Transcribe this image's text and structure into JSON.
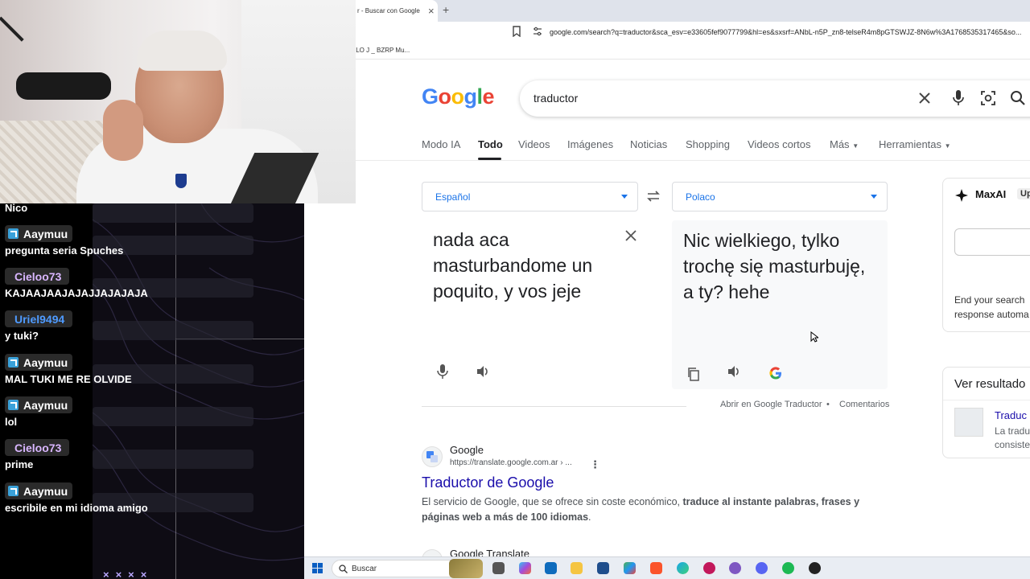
{
  "browser": {
    "tab_title": "r - Buscar con Google",
    "tab_close": "×",
    "new_tab": "+",
    "url": "google.com/search?q=traductor&sca_esv=e33605fef9077799&hl=es&sxsrf=ANbL-n5P_zn8-telseR4m8pGTSWJZ-8N6w%3A1768535317465&so...",
    "bookmark": "ILO J _ BZRP Mu..."
  },
  "google": {
    "logo": [
      "G",
      "o",
      "o",
      "g",
      "l",
      "e"
    ],
    "logo_colors": [
      "#4285F4",
      "#EA4335",
      "#FBBC05",
      "#4285F4",
      "#34A853",
      "#EA4335"
    ],
    "query": "traductor",
    "nav_tabs": [
      "Modo IA",
      "Todo",
      "Videos",
      "Imágenes",
      "Noticias",
      "Shopping",
      "Videos cortos",
      "Más",
      "Herramientas"
    ],
    "active_tab": "Todo"
  },
  "translator": {
    "source_lang": "Español",
    "target_lang": "Polaco",
    "source_text": "nada aca masturbandome un poquito, y vos jeje",
    "target_text": "Nic wielkiego, tylko trochę się masturbuję, a ty? hehe",
    "open_link": "Abrir en Google Traductor",
    "separator": "•",
    "feedback": "Comentarios"
  },
  "results": [
    {
      "source": "Google",
      "url": "https://translate.google.com.ar › ...",
      "title": "Traductor de Google",
      "snippet_plain": "El servicio de Google, que se ofrece sin coste económico, ",
      "snippet_bold": "traduce al instante palabras, frases y páginas web a más de 100 idiomas",
      "snippet_end": "."
    },
    {
      "source": "Google Translate"
    }
  ],
  "sidebar": {
    "maxai_title": "MaxAI",
    "maxai_badge": "Up",
    "maxai_text_1": "End your search",
    "maxai_text_2": "response automa",
    "results_title": "Ver resultado",
    "results_link": "Traduc",
    "results_text_1": "La tradu",
    "results_text_2": "consiste"
  },
  "chat": {
    "top_partial": "Nico",
    "messages": [
      {
        "user": "Aaymuu",
        "color": "#ffffff",
        "badge": true,
        "text": "pregunta seria Spuches"
      },
      {
        "user": "Cieloo73",
        "color": "#d9b6ff",
        "badge": false,
        "text": "KAJAAJAAJAJAJJAJAJAJA"
      },
      {
        "user": "Uriel9494",
        "color": "#4f9bff",
        "badge": false,
        "text": "y tuki?"
      },
      {
        "user": "Aaymuu",
        "color": "#ffffff",
        "badge": true,
        "text": "MAL TUKI ME RE OLVIDE"
      },
      {
        "user": "Aaymuu",
        "color": "#ffffff",
        "badge": true,
        "text": "lol"
      },
      {
        "user": "Cieloo73",
        "color": "#d9b6ff",
        "badge": false,
        "text": "prime"
      },
      {
        "user": "Aaymuu",
        "color": "#ffffff",
        "badge": true,
        "text": "escribile en mi idioma amigo"
      }
    ],
    "footer_marks": "××××"
  },
  "taskbar": {
    "search_label": "Buscar"
  }
}
